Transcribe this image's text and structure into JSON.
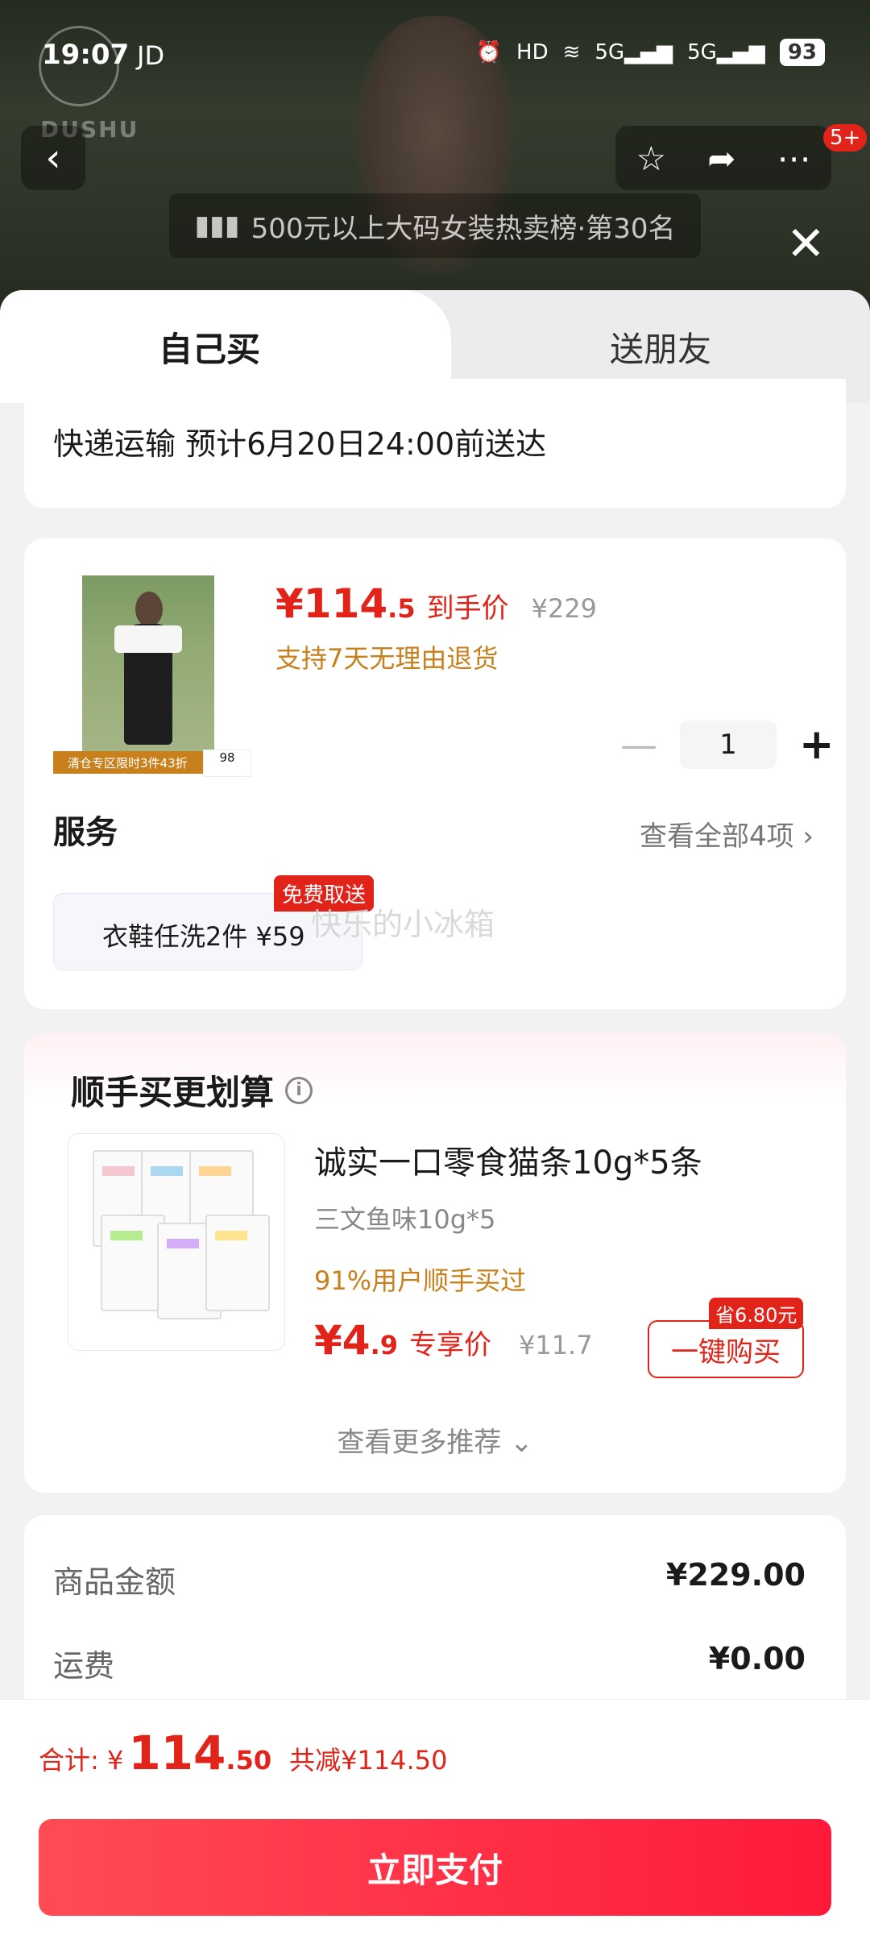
{
  "status": {
    "time": "19:07",
    "carrier": "JD",
    "battery": "93",
    "net1": "5G",
    "net2": "5G"
  },
  "brand": {
    "logo_text": "DUSHU"
  },
  "header": {
    "notifications_badge": "5+",
    "rank_text": "500元以上大码女装热卖榜·第30名"
  },
  "tabs": {
    "self": "自己买",
    "friend": "送朋友"
  },
  "delivery": {
    "text": "快递运输 预计6月20日24:00前送达"
  },
  "product": {
    "price_int": "¥114",
    "price_dec": ".5",
    "price_label": "到手价",
    "old_price": "¥229",
    "return_policy": "支持7天无理由退货",
    "banner": "清仓专区限时3件43折",
    "badge_label": "98",
    "quantity": "1",
    "minus": "—",
    "plus": "+"
  },
  "service": {
    "title": "服务",
    "more": "查看全部4项 ›",
    "chip_label": "衣鞋任洗2件 ¥59",
    "chip_tag": "免费取送",
    "watermark": "快乐的小冰箱"
  },
  "upsell": {
    "title": "顺手买更划算",
    "name": "诚实一口零食猫条10g*5条",
    "spec": "三文鱼味10g*5",
    "bought": "91%用户顺手买过",
    "price_int": "¥4",
    "price_dec": ".9",
    "price_label": "专享价",
    "old_price": "¥11.7",
    "buy_label": "一键购买",
    "save_tag": "省6.80元",
    "more": "查看更多推荐 ⌄"
  },
  "summary": {
    "rows": [
      {
        "k": "商品金额",
        "v": "¥229.00"
      },
      {
        "k": "运费",
        "v": "¥0.00"
      }
    ]
  },
  "bottom": {
    "total_label": "合计: ¥",
    "total_int": "114",
    "total_dec": ".50",
    "discount": "共减¥114.50",
    "pay_label": "立即支付"
  },
  "colors": {
    "accent": "#e2231a",
    "gold": "#c7801c",
    "pay_start": "#ff4b55",
    "pay_end": "#ff1a3a"
  },
  "icons": [
    "back-icon",
    "star-icon",
    "share-icon",
    "more-icon",
    "close-icon",
    "rank-icon",
    "info-icon",
    "chevron-right-icon",
    "chevron-down-icon"
  ]
}
